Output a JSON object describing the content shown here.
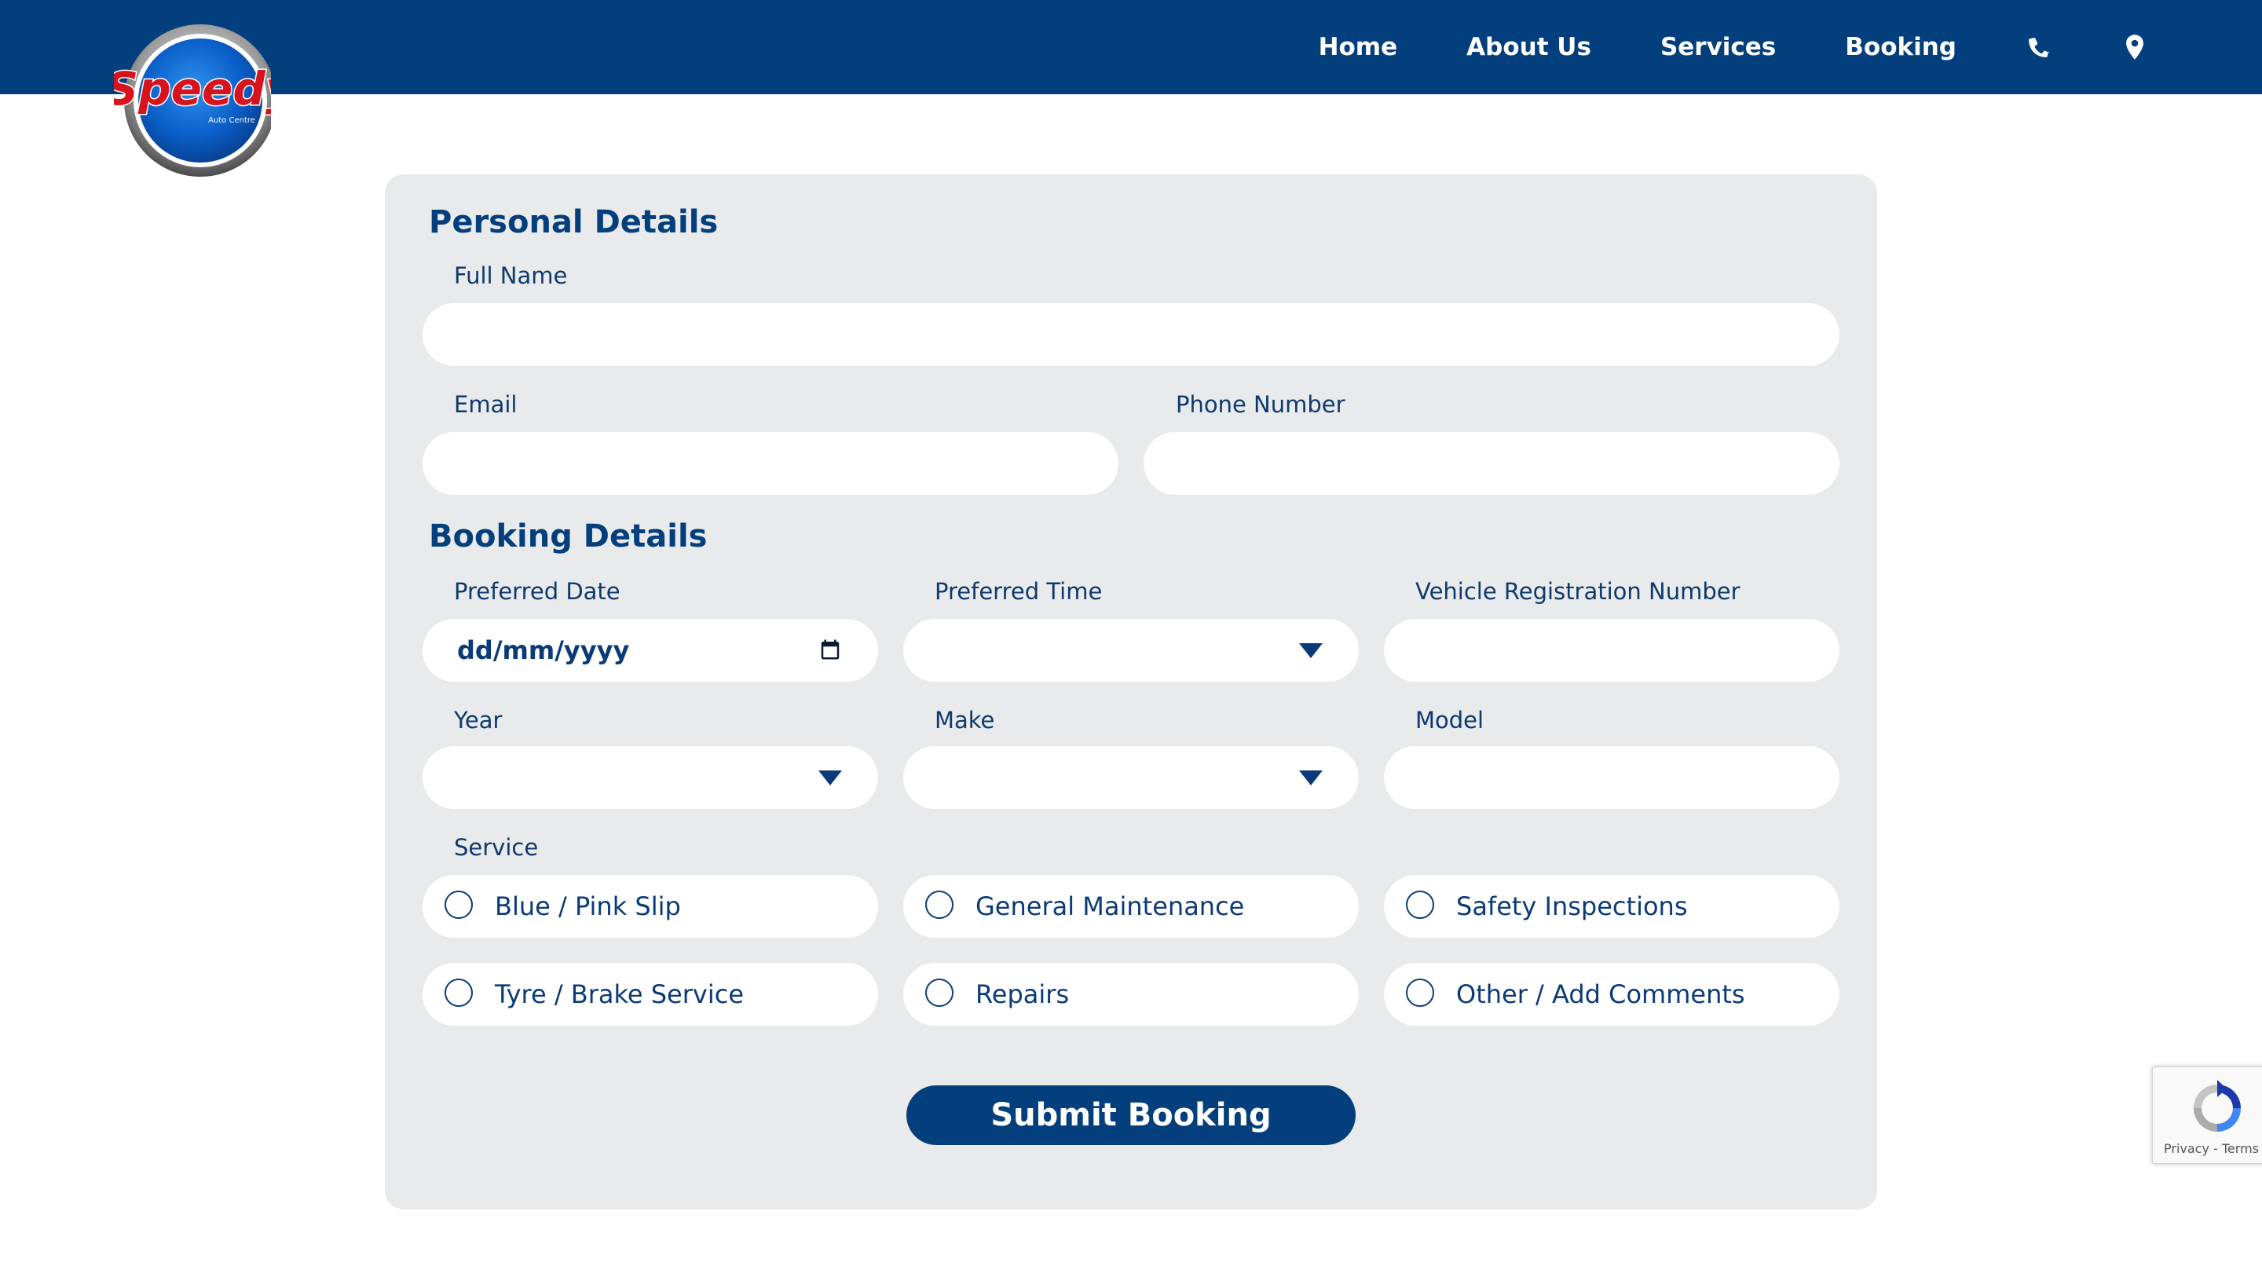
{
  "brand": {
    "logo_text": "Speedy",
    "logo_subtext": "Auto Centre",
    "colors": {
      "primary": "#043f7d",
      "logo_red": "#d7141e",
      "card_bg": "#e9eaec"
    }
  },
  "nav": {
    "items": [
      "Home",
      "About Us",
      "Services",
      "Booking"
    ],
    "icons": [
      "phone-icon",
      "location-pin-icon"
    ]
  },
  "personal": {
    "title": "Personal Details",
    "full_name_label": "Full Name",
    "email_label": "Email",
    "phone_label": "Phone Number"
  },
  "booking": {
    "title": "Booking Details",
    "date_label": "Preferred Date",
    "date_placeholder": "dd/mm/yyyy",
    "time_label": "Preferred Time",
    "rego_label": "Vehicle Registration Number",
    "year_label": "Year",
    "make_label": "Make",
    "model_label": "Model",
    "service_label": "Service",
    "services": [
      "Blue / Pink Slip",
      "General Maintenance",
      "Safety Inspections",
      "Tyre / Brake Service",
      "Repairs",
      "Other / Add Comments"
    ]
  },
  "submit_label": "Submit Booking",
  "recaptcha": {
    "links": "Privacy - Terms"
  }
}
